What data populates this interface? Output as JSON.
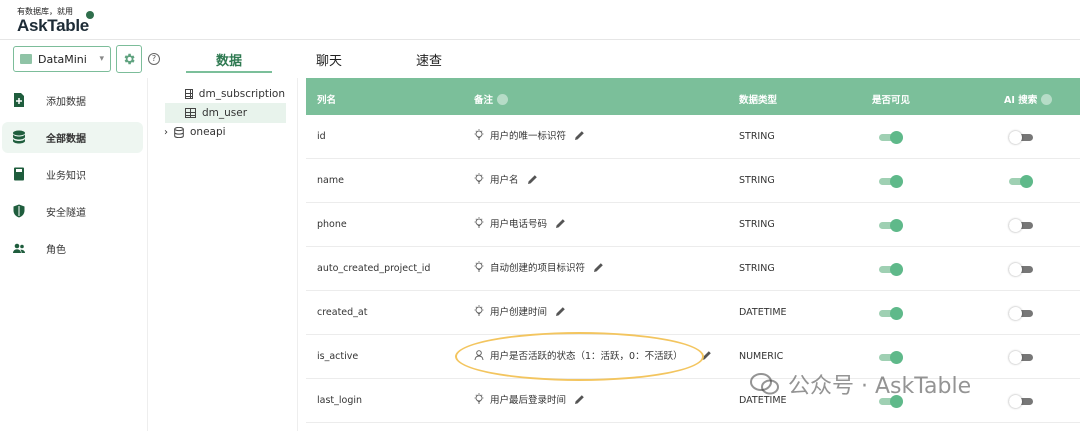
{
  "app": {
    "logo_tagline": "有数据库，就用",
    "logo_name": "AskTable"
  },
  "toolbar": {
    "datasource_value": "DataMini",
    "tabs": [
      {
        "label": "数据"
      },
      {
        "label": "聊天"
      },
      {
        "label": "速查"
      }
    ],
    "active_tab": "数据",
    "help": "?"
  },
  "sidebar": {
    "items": [
      {
        "label": "添加数据",
        "icon": "add-file-icon"
      },
      {
        "label": "全部数据",
        "icon": "database-icon",
        "active": true
      },
      {
        "label": "业务知识",
        "icon": "book-icon"
      },
      {
        "label": "安全隧道",
        "icon": "shield-icon"
      },
      {
        "label": "角色",
        "icon": "users-icon"
      }
    ]
  },
  "tree": {
    "tables": [
      "dm_subscription",
      "dm_user"
    ],
    "selected": "dm_user",
    "schema": "oneapi"
  },
  "grid": {
    "headers": {
      "name": "列名",
      "note": "备注",
      "type": "数据类型",
      "visible": "是否可见",
      "ai": "AI 搜索"
    },
    "rows": [
      {
        "name": "id",
        "note": "用户的唯一标识符",
        "type": "STRING",
        "visible": true,
        "ai": false,
        "note_icon": "bulb-icon"
      },
      {
        "name": "name",
        "note": "用户名",
        "type": "STRING",
        "visible": true,
        "ai": true,
        "note_icon": "bulb-icon"
      },
      {
        "name": "phone",
        "note": "用户电话号码",
        "type": "STRING",
        "visible": true,
        "ai": false,
        "note_icon": "bulb-icon"
      },
      {
        "name": "auto_created_project_id",
        "note": "自动创建的项目标识符",
        "type": "STRING",
        "visible": true,
        "ai": false,
        "note_icon": "bulb-icon"
      },
      {
        "name": "created_at",
        "note": "用户创建时间",
        "type": "DATETIME",
        "visible": true,
        "ai": false,
        "note_icon": "bulb-icon"
      },
      {
        "name": "is_active",
        "note": "用户是否活跃的状态（1：活跃，0：不活跃）",
        "type": "NUMERIC",
        "visible": true,
        "ai": false,
        "note_icon": "user-icon"
      },
      {
        "name": "last_login",
        "note": "用户最后登录时间",
        "type": "DATETIME",
        "visible": true,
        "ai": false,
        "note_icon": "bulb-icon"
      }
    ]
  },
  "watermark": {
    "text": "公众号 · AskTable"
  },
  "colors": {
    "accent": "#7bbf9a",
    "highlight": "#f3c55f"
  }
}
